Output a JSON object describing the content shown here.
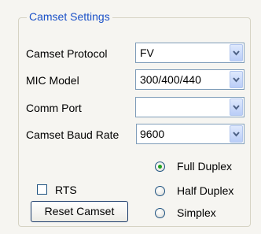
{
  "group_title": "Camset Settings",
  "fields": {
    "protocol": {
      "label": "Camset Protocol",
      "value": "FV"
    },
    "mic_model": {
      "label": "MIC Model",
      "value": "300/400/440"
    },
    "comm_port": {
      "label": "Comm Port",
      "value": ""
    },
    "baud_rate": {
      "label": "Camset Baud Rate",
      "value": "9600"
    }
  },
  "rts": {
    "label": "RTS",
    "checked": false
  },
  "duplex": {
    "options": [
      "Full Duplex",
      "Half Duplex",
      "Simplex"
    ],
    "selected": "Full Duplex"
  },
  "reset_button": "Reset Camset",
  "colors": {
    "legend": "#1c52c8",
    "radio_dot": "#21a121",
    "field_border": "#7f9db9"
  }
}
